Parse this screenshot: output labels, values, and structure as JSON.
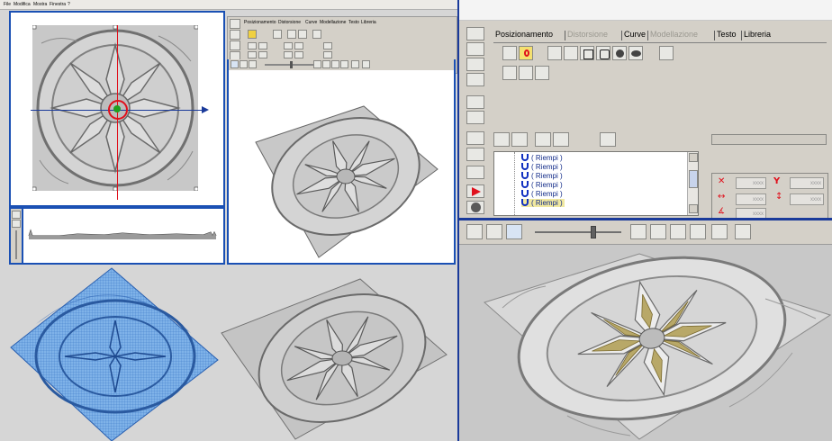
{
  "menu": {
    "file": "File",
    "modifica": "Modifica",
    "mostra": "Mostra",
    "finestra": "Finestra",
    "help": "?"
  },
  "small_tabs": [
    "Posizionamento",
    "Distorsione",
    "Curve",
    "Modellazione",
    "Testo",
    "Libreria"
  ],
  "large_tabs": [
    {
      "label": "Posizionamento",
      "state": "active"
    },
    {
      "label": "Distorsione",
      "state": "disabled"
    },
    {
      "label": "Curve",
      "state": "active"
    },
    {
      "label": "Modellazione",
      "state": "disabled"
    },
    {
      "label": "Testo",
      "state": "active"
    },
    {
      "label": "Libreria",
      "state": "active"
    }
  ],
  "tree": {
    "items": [
      "( Riempi )",
      "( Riempi )",
      "( Riempi )",
      "( Riempi )",
      "( Riempi )",
      "( Riempi )"
    ],
    "selected_index": 5
  },
  "properties": {
    "x_value": "xxxx",
    "y_value": "xxxx",
    "width_value": "xxxx",
    "height_value": "xxxx",
    "angle_value": "xxxx"
  },
  "colors": {
    "window_bg": "#d4d0c8",
    "workspace_bg": "#c8c8c8",
    "panel_blue": "#1a50b4",
    "accent_red": "#e0101c",
    "relief_gold": "#b8a868",
    "mesh_blue": "#4a90d8"
  },
  "icons": {
    "tools_left": [
      "zoom-icon",
      "zoom-fit-icon",
      "pan-hand-icon",
      "arrow-icon",
      "rotate-left-icon",
      "rotate-right-icon",
      "undo-icon",
      "grid-icon",
      "line-icon",
      "play-red-icon",
      "sphere-icon"
    ]
  },
  "view_slider_value": 0.65,
  "small_slider_value": 0.45
}
